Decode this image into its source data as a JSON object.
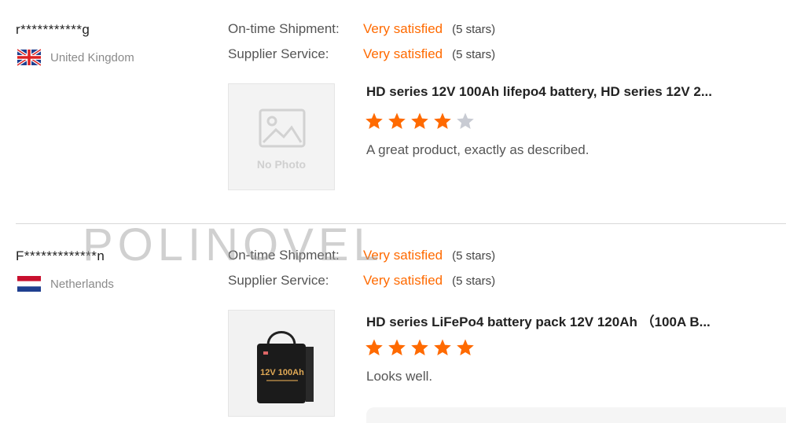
{
  "labels": {
    "on_time_shipment": "On-time Shipment:",
    "supplier_service": "Supplier Service:"
  },
  "reviews": [
    {
      "username": "r***********g",
      "country": "United Kingdom",
      "flag": "uk-flag",
      "on_time_value": "Very satisfied",
      "on_time_count": "(5 stars)",
      "supplier_value": "Very satisfied",
      "supplier_count": "(5 stars)",
      "image_placeholder": "No Photo",
      "product_title": "HD series 12V 100Ah lifepo4 battery, HD series 12V 2...",
      "rating": 4,
      "comment": "A great product, exactly as described."
    },
    {
      "username": "F*************n",
      "country": "Netherlands",
      "flag": "netherlands-flag",
      "on_time_value": "Very satisfied",
      "on_time_count": "(5 stars)",
      "supplier_value": "Very satisfied",
      "supplier_count": "(5 stars)",
      "product_image_text": "12V 100Ah",
      "product_title": "HD series LiFePo4 battery pack 12V 120Ah （100A B...",
      "rating": 5,
      "comment": "Looks well."
    }
  ],
  "watermark": "POLINOVEL",
  "colors": {
    "accent": "#ff6a00",
    "star_empty": "#c8cbd3"
  }
}
